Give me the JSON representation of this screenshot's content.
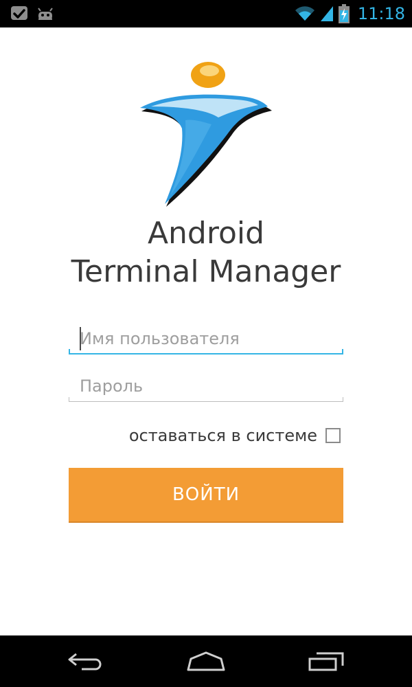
{
  "status_bar": {
    "time": "11:18",
    "time_color": "#33b5e5",
    "left_icons": [
      "check-notification-icon",
      "android-notification-icon"
    ],
    "right_icons": [
      "wifi-icon",
      "cell-signal-icon",
      "battery-charging-icon"
    ]
  },
  "login": {
    "title_line1": "Android",
    "title_line2": "Terminal Manager",
    "username_placeholder": "Имя пользователя",
    "username_value": "",
    "password_placeholder": "Пароль",
    "password_value": "",
    "remember_label": "оставаться в системе",
    "remember_checked": false,
    "login_button_label": "ВОЙТИ",
    "accent_color": "#33b5e5",
    "button_color": "#f39c35"
  },
  "nav_bar": {
    "icons": [
      "back-icon",
      "home-icon",
      "recent-apps-icon"
    ]
  }
}
